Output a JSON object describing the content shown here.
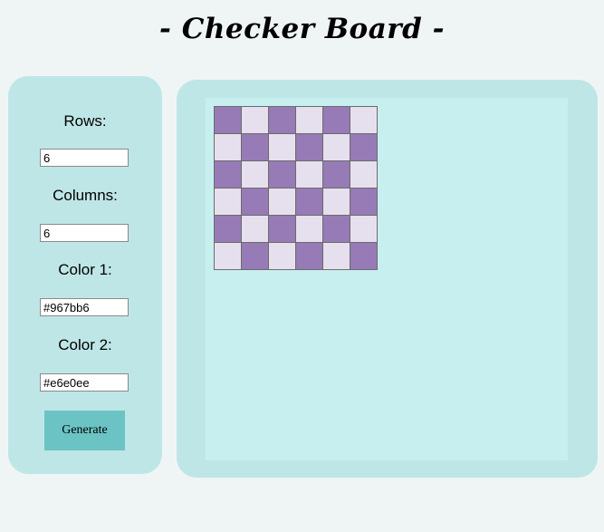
{
  "page": {
    "title": "- Checker Board -"
  },
  "controls": {
    "rows_label": "Rows:",
    "rows_value": "6",
    "columns_label": "Columns:",
    "columns_value": "6",
    "color1_label": "Color 1:",
    "color1_value": "#967bb6",
    "color2_label": "Color 2:",
    "color2_value": "#e6e0ee",
    "generate_label": "Generate"
  },
  "board": {
    "rows": 6,
    "columns": 6,
    "color1": "#967bb6",
    "color2": "#e6e0ee"
  }
}
